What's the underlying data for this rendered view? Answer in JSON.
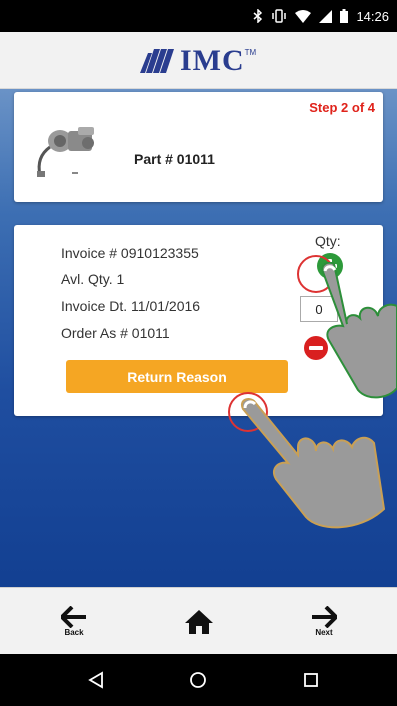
{
  "status_bar": {
    "time": "14:26",
    "icons": [
      "bluetooth-icon",
      "vibrate-icon",
      "wifi-icon",
      "signal-icon",
      "battery-icon"
    ]
  },
  "header": {
    "logo_text": "IMC",
    "logo_mark": "TM",
    "brand_color": "#2a3d8f"
  },
  "part_card": {
    "step": "Step 2 of 4",
    "part_number": "Part # 01011"
  },
  "invoice_card": {
    "invoice_number": "Invoice # 0910123355",
    "available_qty": "Avl. Qty. 1",
    "invoice_date": "Invoice Dt. 11/01/2016",
    "order_as": "Order As # 01011",
    "qty_label": "Qty:",
    "qty_value": "0",
    "return_reason_label": "Return Reason"
  },
  "bottom_nav": {
    "back_label": "Back",
    "next_label": "Next",
    "icons": [
      "back-arrow-icon",
      "home-icon",
      "next-arrow-icon"
    ]
  },
  "system_nav": {
    "icons": [
      "back-triangle-icon",
      "home-circle-icon",
      "recents-square-icon"
    ]
  },
  "colors": {
    "step_red": "#e0231b",
    "plus_green": "#2d9a3a",
    "minus_red": "#d91f1f",
    "return_orange": "#f5a623",
    "background_blue": "#1f4ea0"
  }
}
